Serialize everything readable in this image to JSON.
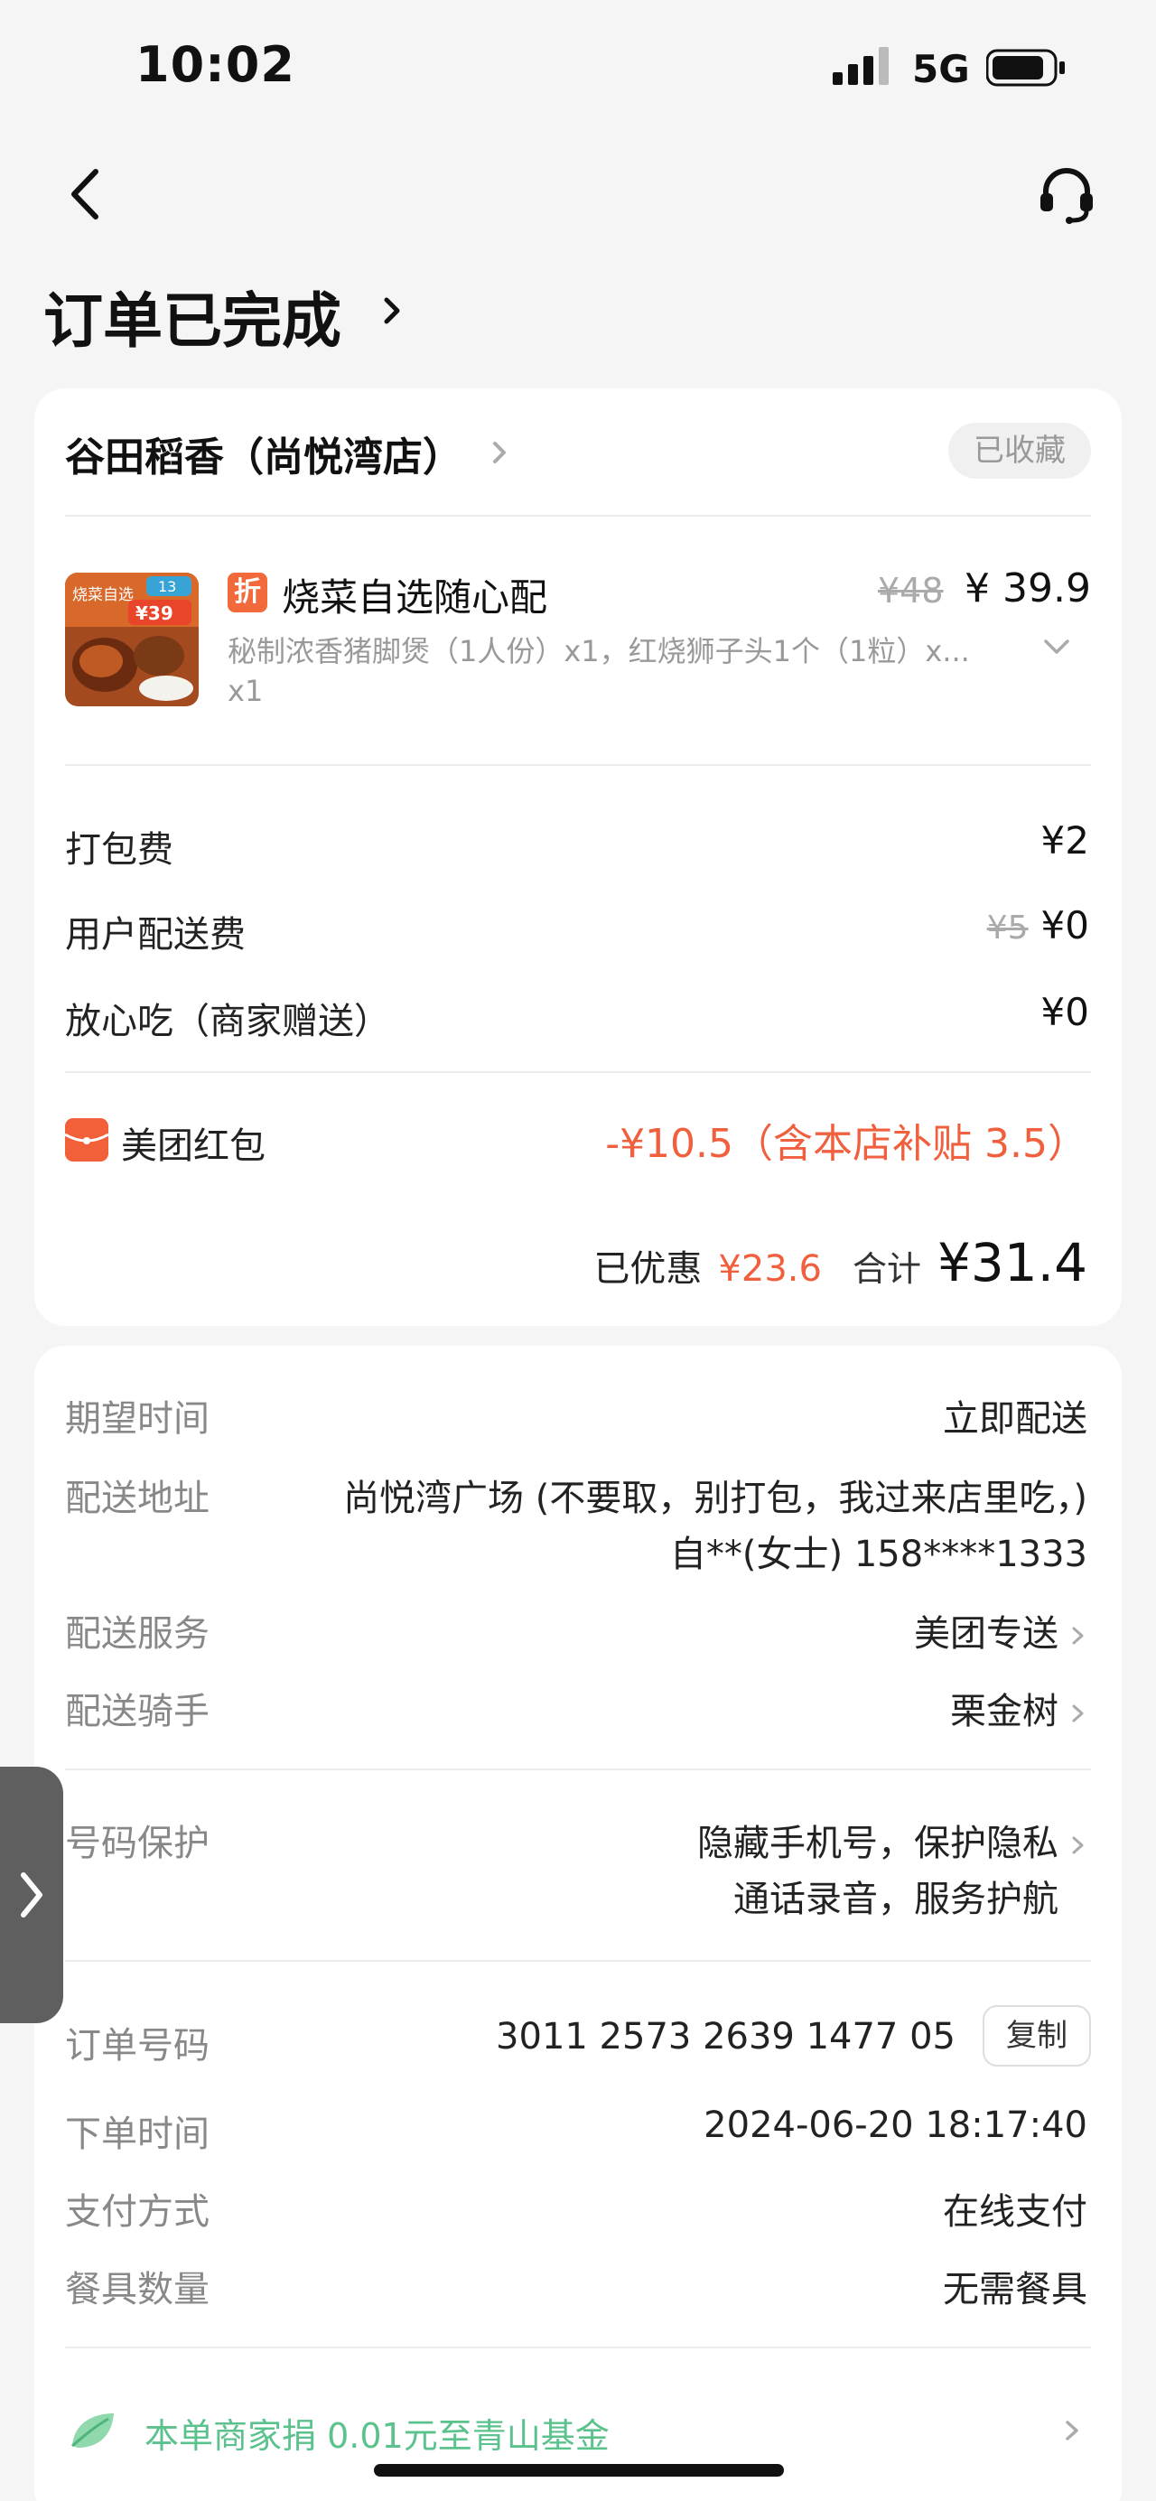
{
  "status": {
    "time": "10:02",
    "network": "5G"
  },
  "header": {
    "title": "订单已完成"
  },
  "shop": {
    "name": "谷田稻香（尚悦湾店）",
    "favorite_badge": "已收藏"
  },
  "dish": {
    "image_text_top": "烧菜自选",
    "image_badge": "13",
    "image_price": "¥39",
    "discount_tag": "折",
    "name": "烧菜自选随心配",
    "original_price": "¥48",
    "price": "¥ 39.9",
    "detail": "秘制浓香猪脚煲（1人份）x1，红烧狮子头1个（1粒）x...",
    "qty": "x1"
  },
  "fees": [
    {
      "label": "打包费",
      "value": "¥2",
      "strike": ""
    },
    {
      "label": "用户配送费",
      "value": "¥0",
      "strike": "¥5"
    },
    {
      "label": "放心吃（商家赠送）",
      "value": "¥0",
      "strike": ""
    }
  ],
  "red_packet": {
    "label": "美团红包",
    "value": "-¥10.5（含本店补贴 3.5）"
  },
  "summary": {
    "saved_label": "已优惠",
    "saved_value": "¥23.6",
    "total_label": "合计",
    "total_value": "¥31.4"
  },
  "delivery": {
    "expected_time_label": "期望时间",
    "expected_time_value": "立即配送",
    "address_label": "配送地址",
    "address_line1": "尚悦湾广场 (不要取，别打包，我过来店里吃，)",
    "address_line2": "自**(女士) 158****1333",
    "service_label": "配送服务",
    "service_value": "美团专送",
    "rider_label": "配送骑手",
    "rider_value": "栗金树",
    "privacy_label": "号码保护",
    "privacy_line1": "隐藏手机号，保护隐私",
    "privacy_line2": "通话录音，服务护航"
  },
  "order": {
    "number_label": "订单号码",
    "number_value": "3011 2573 2639 1477 05",
    "copy_label": "复制",
    "time_label": "下单时间",
    "time_value": "2024-06-20 18:17:40",
    "payment_label": "支付方式",
    "payment_value": "在线支付",
    "utensils_label": "餐具数量",
    "utensils_value": "无需餐具"
  },
  "donation": {
    "text": "本单商家捐 0.01元至青山基金"
  },
  "colors": {
    "accent_red": "#f0603e",
    "green": "#5cc28d",
    "muted": "#888888"
  }
}
